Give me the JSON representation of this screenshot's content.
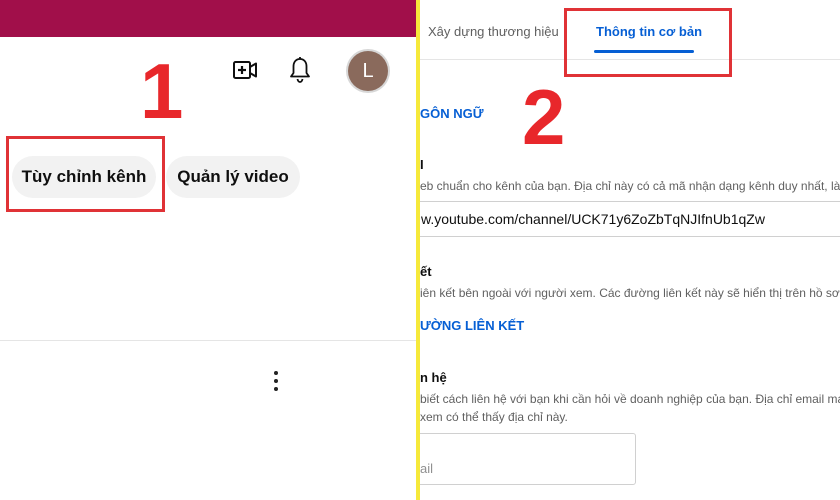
{
  "left": {
    "step_number": "1",
    "avatar_letter": "L",
    "buttons": {
      "customize_channel": "Tùy chỉnh kênh",
      "manage_videos": "Quản lý video"
    },
    "icons": {
      "create": "create-video-icon",
      "notifications": "bell-icon",
      "more": "more-vert-icon"
    },
    "colors": {
      "banner": "#a10f4a",
      "highlight": "#e03236",
      "step_number": "#e8272b"
    }
  },
  "right": {
    "step_number": "2",
    "tabs": [
      {
        "label": "Xây dựng thương hiệu"
      },
      {
        "label": "Thông tin cơ bản"
      }
    ],
    "sections": {
      "language_heading": "GÔN NGỮ",
      "links_heading": "ƯỜNG LIÊN KẾT"
    },
    "url_field": {
      "title": "I",
      "description": "eb chuẩn cho kênh của bạn. Địa chỉ này có cả mã nhận dạng kênh duy nhất, là",
      "value": "w.youtube.com/channel/UCK71y6ZoZbTqNJIfnUb1qZw"
    },
    "links_field": {
      "title": "ết",
      "description": "iên kết bên ngoài với người xem. Các đường liên kết này sẽ hiển thị trên hồ sơ"
    },
    "contact_field": {
      "title": "n hệ",
      "description_1": "biết cách liên hệ với bạn khi cần hỏi về doanh nghiệp của bạn. Địa chỉ email ma",
      "description_2": "xem có thể thấy địa chỉ này.",
      "email_placeholder": "ail"
    },
    "colors": {
      "accent": "#065fd4",
      "separator": "#f6e93a"
    }
  }
}
